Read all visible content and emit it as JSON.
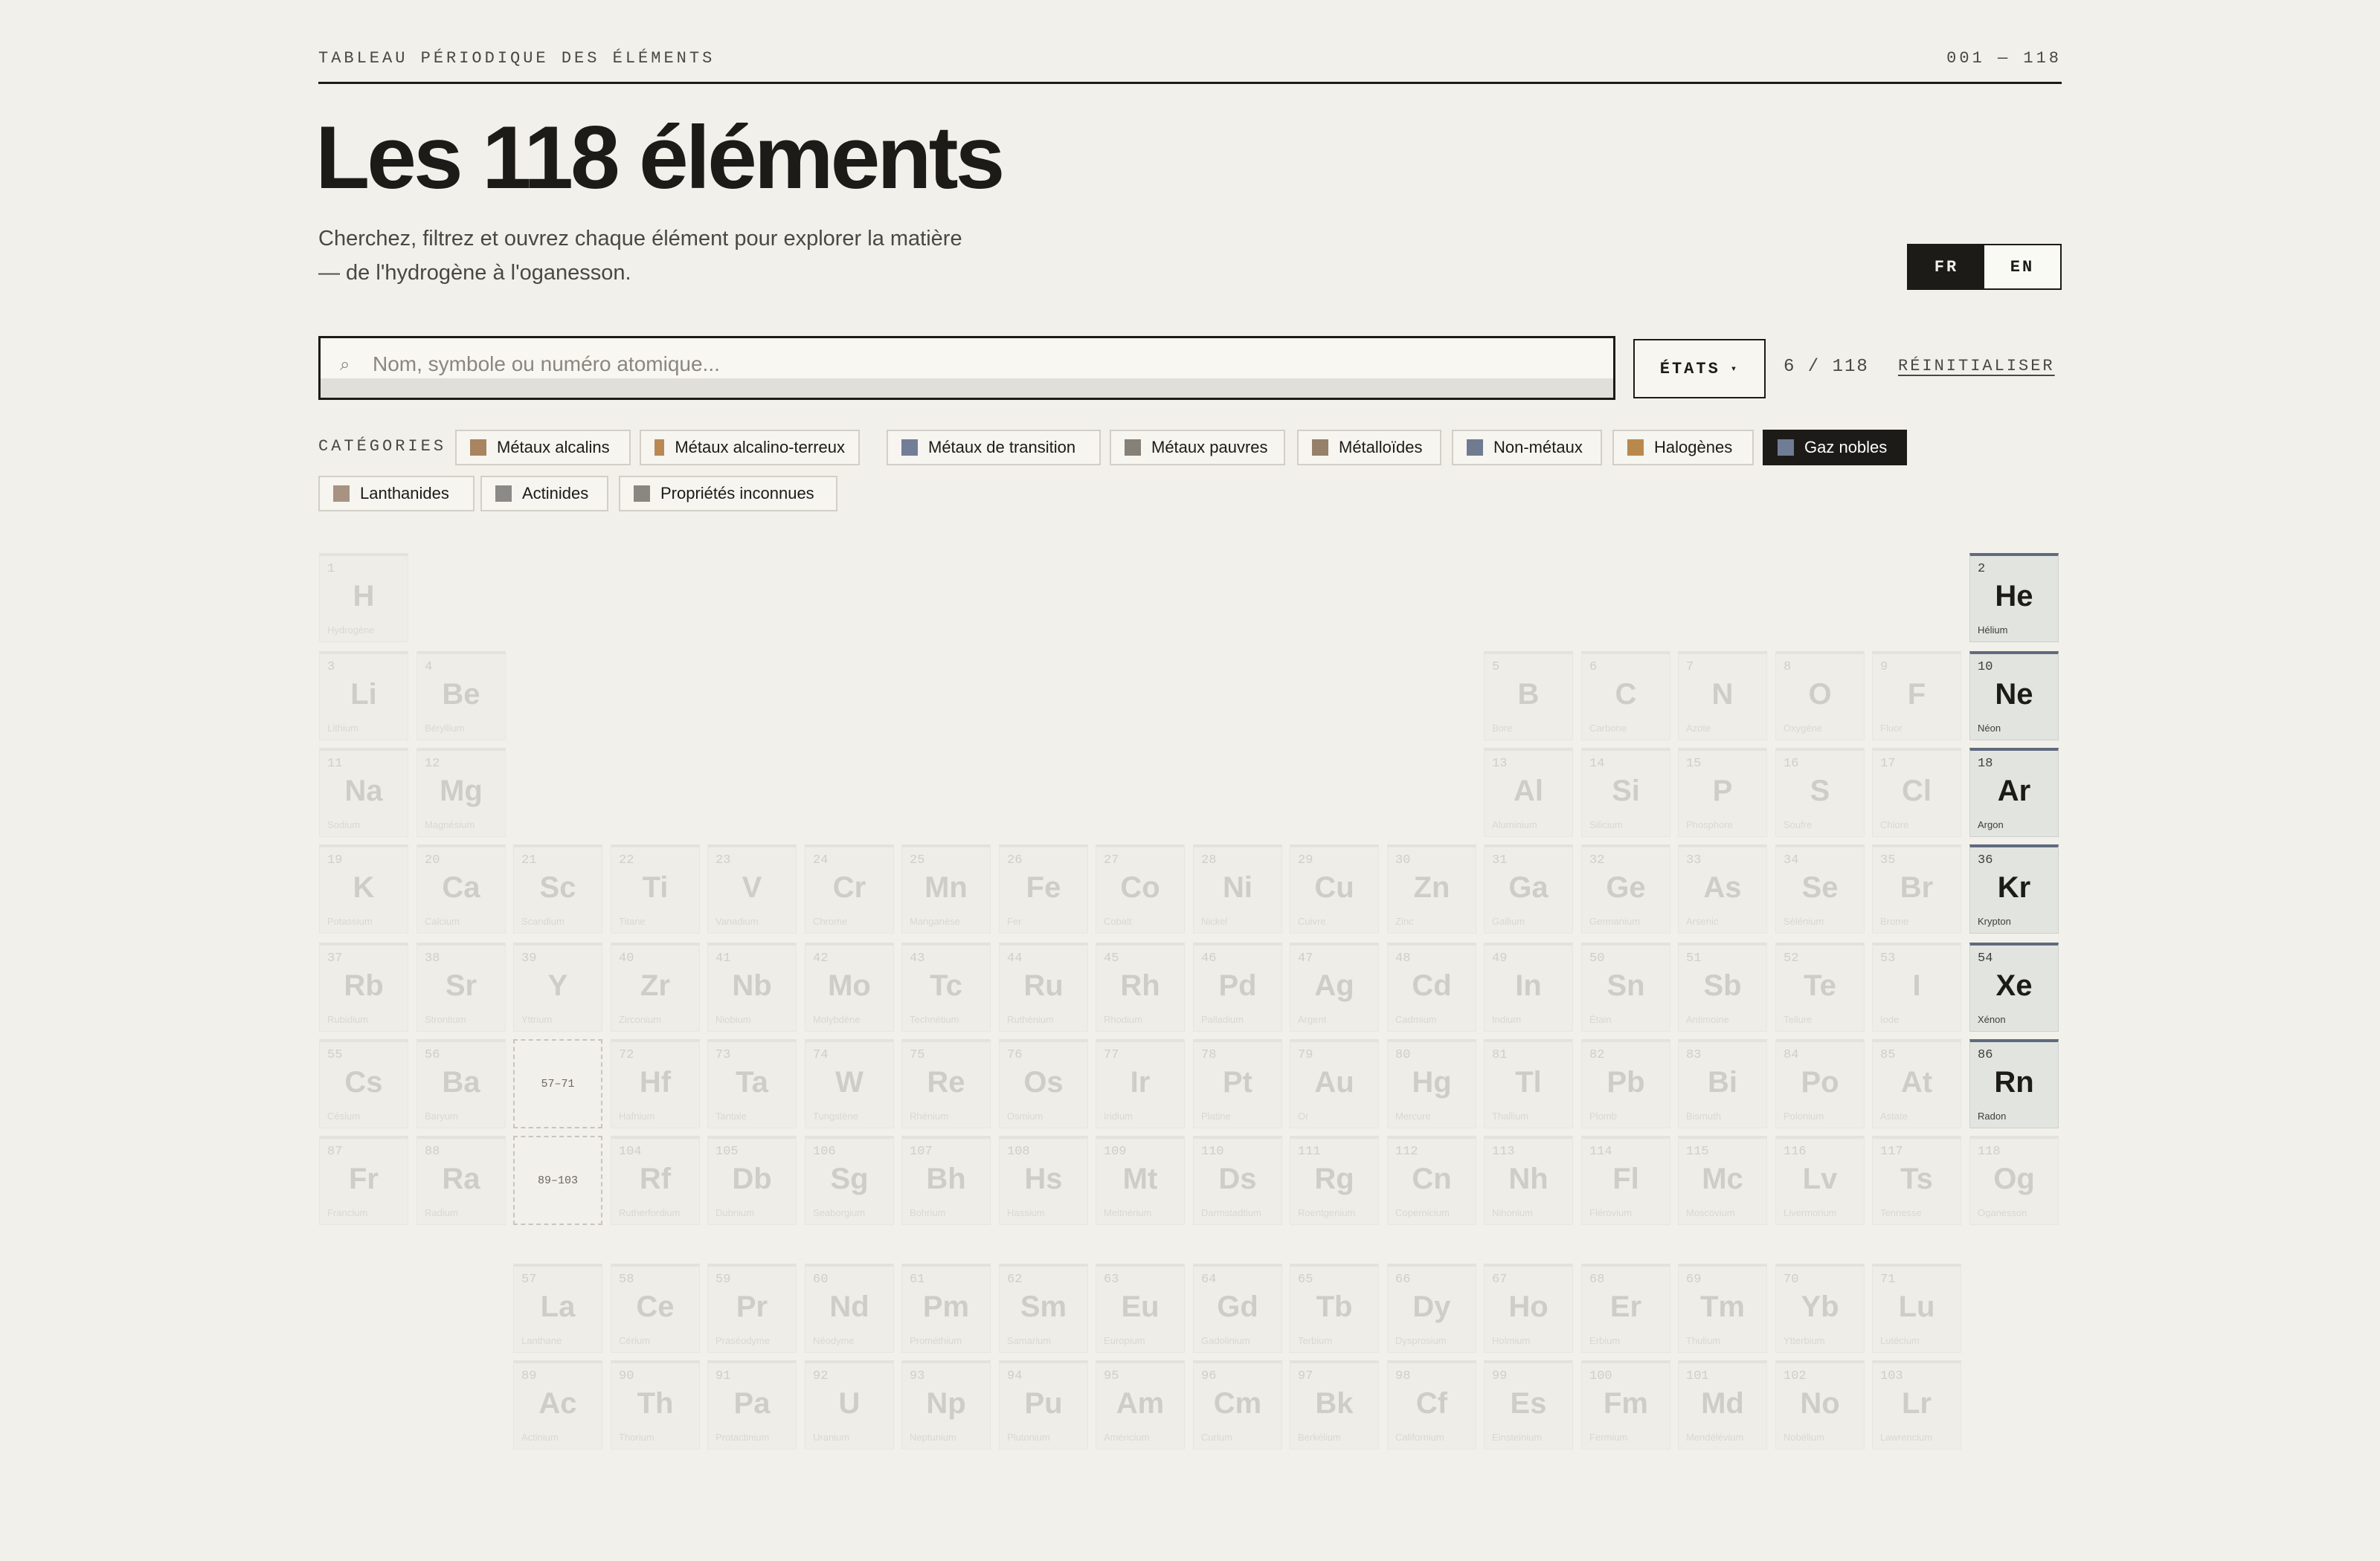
{
  "header": {
    "eyebrow": "TABLEAU PÉRIODIQUE DES ÉLÉMENTS",
    "range": "001 — 118",
    "title": "Les 118 éléments",
    "subtitle_line1": "Cherchez, filtrez et ouvrez chaque élément pour explorer la matière",
    "subtitle_line2": "— de l'hydrogène à l'oganesson."
  },
  "language": {
    "fr": "FR",
    "en": "EN",
    "active": "FR"
  },
  "search": {
    "placeholder": "Nom, symbole ou numéro atomique...",
    "value": "",
    "icon": "search-icon"
  },
  "filters": {
    "states_label": "ÉTATS",
    "count": "6 / 118",
    "reset_label": "RÉINITIALISER"
  },
  "categories": {
    "label": "CATÉGORIES",
    "items": [
      {
        "label": "Métaux alcalins",
        "color": "#a88460",
        "active": false
      },
      {
        "label": "Métaux alcalino-terreux",
        "color": "#b88a52",
        "active": false
      },
      {
        "label": "Métaux de transition",
        "color": "#727d98",
        "active": false
      },
      {
        "label": "Métaux pauvres",
        "color": "#858178",
        "active": false
      },
      {
        "label": "Métalloïdes",
        "color": "#968069",
        "active": false
      },
      {
        "label": "Non-métaux",
        "color": "#707b92",
        "active": false
      },
      {
        "label": "Halogènes",
        "color": "#b9894c",
        "active": false
      },
      {
        "label": "Gaz nobles",
        "color": "#707b94",
        "active": true
      },
      {
        "label": "Lanthanides",
        "color": "#a89282",
        "active": false
      },
      {
        "label": "Actinides",
        "color": "#8c8a86",
        "active": false
      },
      {
        "label": "Propriétés inconnues",
        "color": "#8a8680",
        "active": false
      }
    ]
  },
  "placeholders": {
    "lanthanides": "57–71",
    "actinides": "89–103"
  },
  "elements": [
    {
      "n": 1,
      "s": "H",
      "name": "Hydrogène",
      "p": 1,
      "g": 1
    },
    {
      "n": 2,
      "s": "He",
      "name": "Hélium",
      "p": 1,
      "g": 18,
      "hl": true
    },
    {
      "n": 3,
      "s": "Li",
      "name": "Lithium",
      "p": 2,
      "g": 1
    },
    {
      "n": 4,
      "s": "Be",
      "name": "Béryllium",
      "p": 2,
      "g": 2
    },
    {
      "n": 5,
      "s": "B",
      "name": "Bore",
      "p": 2,
      "g": 13
    },
    {
      "n": 6,
      "s": "C",
      "name": "Carbone",
      "p": 2,
      "g": 14
    },
    {
      "n": 7,
      "s": "N",
      "name": "Azote",
      "p": 2,
      "g": 15
    },
    {
      "n": 8,
      "s": "O",
      "name": "Oxygène",
      "p": 2,
      "g": 16
    },
    {
      "n": 9,
      "s": "F",
      "name": "Fluor",
      "p": 2,
      "g": 17
    },
    {
      "n": 10,
      "s": "Ne",
      "name": "Néon",
      "p": 2,
      "g": 18,
      "hl": true
    },
    {
      "n": 11,
      "s": "Na",
      "name": "Sodium",
      "p": 3,
      "g": 1
    },
    {
      "n": 12,
      "s": "Mg",
      "name": "Magnésium",
      "p": 3,
      "g": 2
    },
    {
      "n": 13,
      "s": "Al",
      "name": "Aluminium",
      "p": 3,
      "g": 13
    },
    {
      "n": 14,
      "s": "Si",
      "name": "Silicium",
      "p": 3,
      "g": 14
    },
    {
      "n": 15,
      "s": "P",
      "name": "Phosphore",
      "p": 3,
      "g": 15
    },
    {
      "n": 16,
      "s": "S",
      "name": "Soufre",
      "p": 3,
      "g": 16
    },
    {
      "n": 17,
      "s": "Cl",
      "name": "Chlore",
      "p": 3,
      "g": 17
    },
    {
      "n": 18,
      "s": "Ar",
      "name": "Argon",
      "p": 3,
      "g": 18,
      "hl": true
    },
    {
      "n": 19,
      "s": "K",
      "name": "Potassium",
      "p": 4,
      "g": 1
    },
    {
      "n": 20,
      "s": "Ca",
      "name": "Calcium",
      "p": 4,
      "g": 2
    },
    {
      "n": 21,
      "s": "Sc",
      "name": "Scandium",
      "p": 4,
      "g": 3
    },
    {
      "n": 22,
      "s": "Ti",
      "name": "Titane",
      "p": 4,
      "g": 4
    },
    {
      "n": 23,
      "s": "V",
      "name": "Vanadium",
      "p": 4,
      "g": 5
    },
    {
      "n": 24,
      "s": "Cr",
      "name": "Chrome",
      "p": 4,
      "g": 6
    },
    {
      "n": 25,
      "s": "Mn",
      "name": "Manganèse",
      "p": 4,
      "g": 7
    },
    {
      "n": 26,
      "s": "Fe",
      "name": "Fer",
      "p": 4,
      "g": 8
    },
    {
      "n": 27,
      "s": "Co",
      "name": "Cobalt",
      "p": 4,
      "g": 9
    },
    {
      "n": 28,
      "s": "Ni",
      "name": "Nickel",
      "p": 4,
      "g": 10
    },
    {
      "n": 29,
      "s": "Cu",
      "name": "Cuivre",
      "p": 4,
      "g": 11
    },
    {
      "n": 30,
      "s": "Zn",
      "name": "Zinc",
      "p": 4,
      "g": 12
    },
    {
      "n": 31,
      "s": "Ga",
      "name": "Gallium",
      "p": 4,
      "g": 13
    },
    {
      "n": 32,
      "s": "Ge",
      "name": "Germanium",
      "p": 4,
      "g": 14
    },
    {
      "n": 33,
      "s": "As",
      "name": "Arsenic",
      "p": 4,
      "g": 15
    },
    {
      "n": 34,
      "s": "Se",
      "name": "Sélénium",
      "p": 4,
      "g": 16
    },
    {
      "n": 35,
      "s": "Br",
      "name": "Brome",
      "p": 4,
      "g": 17
    },
    {
      "n": 36,
      "s": "Kr",
      "name": "Krypton",
      "p": 4,
      "g": 18,
      "hl": true
    },
    {
      "n": 37,
      "s": "Rb",
      "name": "Rubidium",
      "p": 5,
      "g": 1
    },
    {
      "n": 38,
      "s": "Sr",
      "name": "Strontium",
      "p": 5,
      "g": 2
    },
    {
      "n": 39,
      "s": "Y",
      "name": "Yttrium",
      "p": 5,
      "g": 3
    },
    {
      "n": 40,
      "s": "Zr",
      "name": "Zirconium",
      "p": 5,
      "g": 4
    },
    {
      "n": 41,
      "s": "Nb",
      "name": "Niobium",
      "p": 5,
      "g": 5
    },
    {
      "n": 42,
      "s": "Mo",
      "name": "Molybdène",
      "p": 5,
      "g": 6
    },
    {
      "n": 43,
      "s": "Tc",
      "name": "Technétium",
      "p": 5,
      "g": 7
    },
    {
      "n": 44,
      "s": "Ru",
      "name": "Ruthénium",
      "p": 5,
      "g": 8
    },
    {
      "n": 45,
      "s": "Rh",
      "name": "Rhodium",
      "p": 5,
      "g": 9
    },
    {
      "n": 46,
      "s": "Pd",
      "name": "Palladium",
      "p": 5,
      "g": 10
    },
    {
      "n": 47,
      "s": "Ag",
      "name": "Argent",
      "p": 5,
      "g": 11
    },
    {
      "n": 48,
      "s": "Cd",
      "name": "Cadmium",
      "p": 5,
      "g": 12
    },
    {
      "n": 49,
      "s": "In",
      "name": "Indium",
      "p": 5,
      "g": 13
    },
    {
      "n": 50,
      "s": "Sn",
      "name": "Étain",
      "p": 5,
      "g": 14
    },
    {
      "n": 51,
      "s": "Sb",
      "name": "Antimoine",
      "p": 5,
      "g": 15
    },
    {
      "n": 52,
      "s": "Te",
      "name": "Tellure",
      "p": 5,
      "g": 16
    },
    {
      "n": 53,
      "s": "I",
      "name": "Iode",
      "p": 5,
      "g": 17
    },
    {
      "n": 54,
      "s": "Xe",
      "name": "Xénon",
      "p": 5,
      "g": 18,
      "hl": true
    },
    {
      "n": 55,
      "s": "Cs",
      "name": "Césium",
      "p": 6,
      "g": 1
    },
    {
      "n": 56,
      "s": "Ba",
      "name": "Baryum",
      "p": 6,
      "g": 2
    },
    {
      "n": 72,
      "s": "Hf",
      "name": "Hafnium",
      "p": 6,
      "g": 4
    },
    {
      "n": 73,
      "s": "Ta",
      "name": "Tantale",
      "p": 6,
      "g": 5
    },
    {
      "n": 74,
      "s": "W",
      "name": "Tungstène",
      "p": 6,
      "g": 6
    },
    {
      "n": 75,
      "s": "Re",
      "name": "Rhénium",
      "p": 6,
      "g": 7
    },
    {
      "n": 76,
      "s": "Os",
      "name": "Osmium",
      "p": 6,
      "g": 8
    },
    {
      "n": 77,
      "s": "Ir",
      "name": "Iridium",
      "p": 6,
      "g": 9
    },
    {
      "n": 78,
      "s": "Pt",
      "name": "Platine",
      "p": 6,
      "g": 10
    },
    {
      "n": 79,
      "s": "Au",
      "name": "Or",
      "p": 6,
      "g": 11
    },
    {
      "n": 80,
      "s": "Hg",
      "name": "Mercure",
      "p": 6,
      "g": 12
    },
    {
      "n": 81,
      "s": "Tl",
      "name": "Thallium",
      "p": 6,
      "g": 13
    },
    {
      "n": 82,
      "s": "Pb",
      "name": "Plomb",
      "p": 6,
      "g": 14
    },
    {
      "n": 83,
      "s": "Bi",
      "name": "Bismuth",
      "p": 6,
      "g": 15
    },
    {
      "n": 84,
      "s": "Po",
      "name": "Polonium",
      "p": 6,
      "g": 16
    },
    {
      "n": 85,
      "s": "At",
      "name": "Astate",
      "p": 6,
      "g": 17
    },
    {
      "n": 86,
      "s": "Rn",
      "name": "Radon",
      "p": 6,
      "g": 18,
      "hl": true
    },
    {
      "n": 87,
      "s": "Fr",
      "name": "Francium",
      "p": 7,
      "g": 1
    },
    {
      "n": 88,
      "s": "Ra",
      "name": "Radium",
      "p": 7,
      "g": 2
    },
    {
      "n": 104,
      "s": "Rf",
      "name": "Rutherfordium",
      "p": 7,
      "g": 4
    },
    {
      "n": 105,
      "s": "Db",
      "name": "Dubnium",
      "p": 7,
      "g": 5
    },
    {
      "n": 106,
      "s": "Sg",
      "name": "Seaborgium",
      "p": 7,
      "g": 6
    },
    {
      "n": 107,
      "s": "Bh",
      "name": "Bohrium",
      "p": 7,
      "g": 7
    },
    {
      "n": 108,
      "s": "Hs",
      "name": "Hassium",
      "p": 7,
      "g": 8
    },
    {
      "n": 109,
      "s": "Mt",
      "name": "Meitnérium",
      "p": 7,
      "g": 9
    },
    {
      "n": 110,
      "s": "Ds",
      "name": "Darmstadtium",
      "p": 7,
      "g": 10
    },
    {
      "n": 111,
      "s": "Rg",
      "name": "Roentgenium",
      "p": 7,
      "g": 11
    },
    {
      "n": 112,
      "s": "Cn",
      "name": "Copernicium",
      "p": 7,
      "g": 12
    },
    {
      "n": 113,
      "s": "Nh",
      "name": "Nihonium",
      "p": 7,
      "g": 13
    },
    {
      "n": 114,
      "s": "Fl",
      "name": "Flérovium",
      "p": 7,
      "g": 14
    },
    {
      "n": 115,
      "s": "Mc",
      "name": "Moscovium",
      "p": 7,
      "g": 15
    },
    {
      "n": 116,
      "s": "Lv",
      "name": "Livermorium",
      "p": 7,
      "g": 16
    },
    {
      "n": 117,
      "s": "Ts",
      "name": "Tennesse",
      "p": 7,
      "g": 17
    },
    {
      "n": 118,
      "s": "Og",
      "name": "Oganesson",
      "p": 7,
      "g": 18
    },
    {
      "n": 57,
      "s": "La",
      "name": "Lanthane",
      "p": 9,
      "g": 3
    },
    {
      "n": 58,
      "s": "Ce",
      "name": "Cérium",
      "p": 9,
      "g": 4
    },
    {
      "n": 59,
      "s": "Pr",
      "name": "Praséodyme",
      "p": 9,
      "g": 5
    },
    {
      "n": 60,
      "s": "Nd",
      "name": "Néodyme",
      "p": 9,
      "g": 6
    },
    {
      "n": 61,
      "s": "Pm",
      "name": "Prométhium",
      "p": 9,
      "g": 7
    },
    {
      "n": 62,
      "s": "Sm",
      "name": "Samarium",
      "p": 9,
      "g": 8
    },
    {
      "n": 63,
      "s": "Eu",
      "name": "Europium",
      "p": 9,
      "g": 9
    },
    {
      "n": 64,
      "s": "Gd",
      "name": "Gadolinium",
      "p": 9,
      "g": 10
    },
    {
      "n": 65,
      "s": "Tb",
      "name": "Terbium",
      "p": 9,
      "g": 11
    },
    {
      "n": 66,
      "s": "Dy",
      "name": "Dysprosium",
      "p": 9,
      "g": 12
    },
    {
      "n": 67,
      "s": "Ho",
      "name": "Holmium",
      "p": 9,
      "g": 13
    },
    {
      "n": 68,
      "s": "Er",
      "name": "Erbium",
      "p": 9,
      "g": 14
    },
    {
      "n": 69,
      "s": "Tm",
      "name": "Thulium",
      "p": 9,
      "g": 15
    },
    {
      "n": 70,
      "s": "Yb",
      "name": "Ytterbium",
      "p": 9,
      "g": 16
    },
    {
      "n": 71,
      "s": "Lu",
      "name": "Lutécium",
      "p": 9,
      "g": 17
    },
    {
      "n": 89,
      "s": "Ac",
      "name": "Actinium",
      "p": 10,
      "g": 3
    },
    {
      "n": 90,
      "s": "Th",
      "name": "Thorium",
      "p": 10,
      "g": 4
    },
    {
      "n": 91,
      "s": "Pa",
      "name": "Protactinium",
      "p": 10,
      "g": 5
    },
    {
      "n": 92,
      "s": "U",
      "name": "Uranium",
      "p": 10,
      "g": 6
    },
    {
      "n": 93,
      "s": "Np",
      "name": "Neptunium",
      "p": 10,
      "g": 7
    },
    {
      "n": 94,
      "s": "Pu",
      "name": "Plutonium",
      "p": 10,
      "g": 8
    },
    {
      "n": 95,
      "s": "Am",
      "name": "Américium",
      "p": 10,
      "g": 9
    },
    {
      "n": 96,
      "s": "Cm",
      "name": "Curium",
      "p": 10,
      "g": 10
    },
    {
      "n": 97,
      "s": "Bk",
      "name": "Berkélium",
      "p": 10,
      "g": 11
    },
    {
      "n": 98,
      "s": "Cf",
      "name": "Californium",
      "p": 10,
      "g": 12
    },
    {
      "n": 99,
      "s": "Es",
      "name": "Einsteinium",
      "p": 10,
      "g": 13
    },
    {
      "n": 100,
      "s": "Fm",
      "name": "Fermium",
      "p": 10,
      "g": 14
    },
    {
      "n": 101,
      "s": "Md",
      "name": "Mendélévium",
      "p": 10,
      "g": 15
    },
    {
      "n": 102,
      "s": "No",
      "name": "Nobélium",
      "p": 10,
      "g": 16
    },
    {
      "n": 103,
      "s": "Lr",
      "name": "Lawrencium",
      "p": 10,
      "g": 17
    }
  ]
}
